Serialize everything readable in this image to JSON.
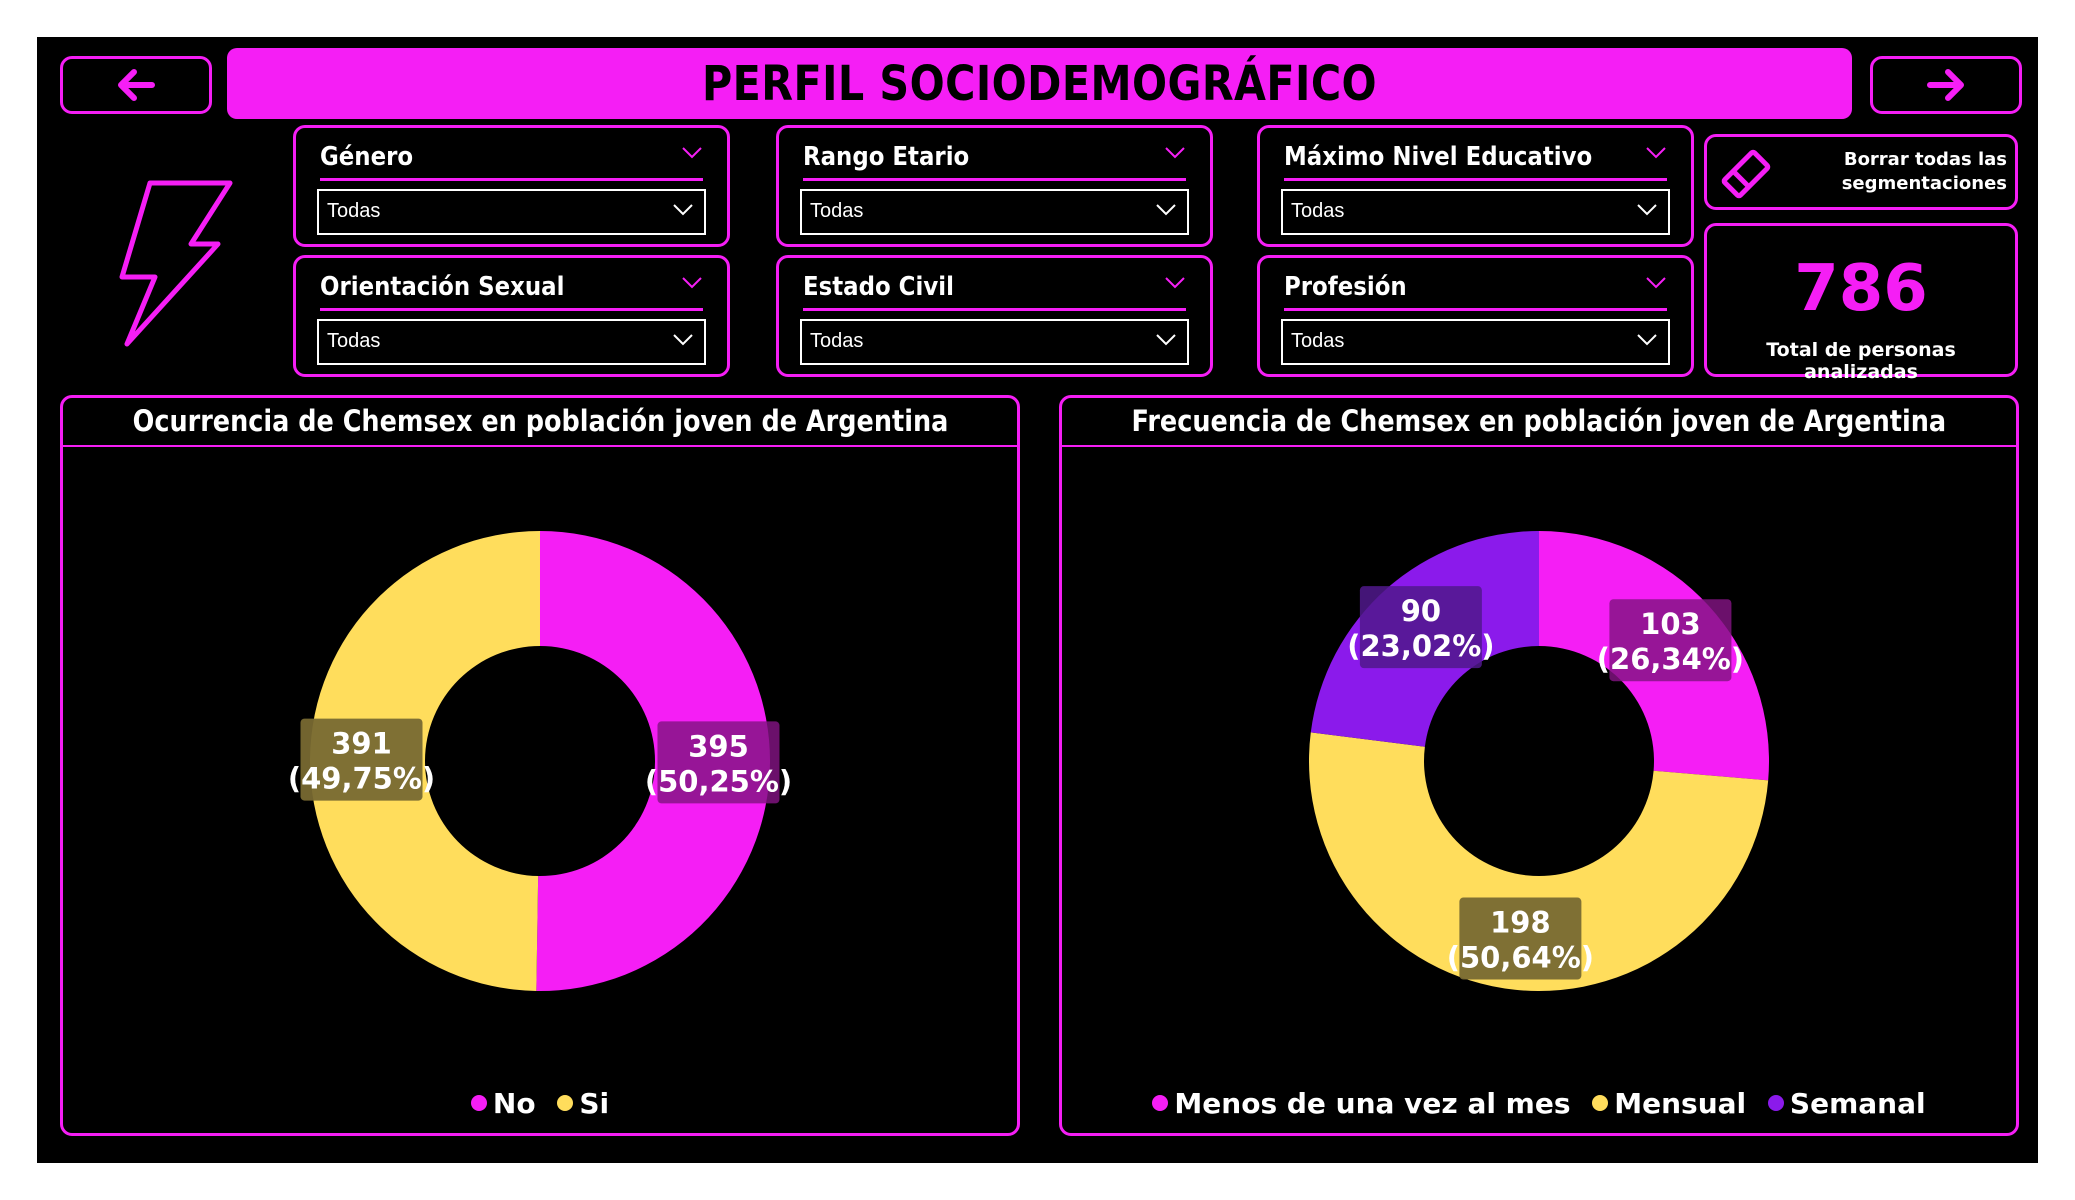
{
  "header": {
    "title": "PERFIL SOCIODEMOGRÁFICO",
    "back_icon": "arrow-left-icon",
    "forward_icon": "arrow-right-icon",
    "logo_icon": "lightning-bolt-icon"
  },
  "filters": [
    {
      "label": "Género",
      "value": "Todas"
    },
    {
      "label": "Rango Etario",
      "value": "Todas"
    },
    {
      "label": "Máximo Nivel Educativo",
      "value": "Todas"
    },
    {
      "label": "Orientación Sexual",
      "value": "Todas"
    },
    {
      "label": "Estado Civil",
      "value": "Todas"
    },
    {
      "label": "Profesión",
      "value": "Todas"
    }
  ],
  "clear_button": {
    "label_line1": "Borrar todas las",
    "label_line2": "segmentaciones",
    "icon": "eraser-icon"
  },
  "kpi": {
    "value": "786",
    "label": "Total de personas analizadas"
  },
  "colors": {
    "accent": "#f51ef5",
    "yellow": "#ffdd5c",
    "purple": "#8b1aeb",
    "background": "#000000"
  },
  "chart_data": [
    {
      "type": "pie",
      "title": "Ocurrencia de Chemsex en población joven de Argentina",
      "categories": [
        "No",
        "Si"
      ],
      "values": [
        395,
        391
      ],
      "labels": [
        {
          "value": "395",
          "percent": "(50,25%)"
        },
        {
          "value": "391",
          "percent": "(49,75%)"
        }
      ],
      "colors": [
        "#f51ef5",
        "#ffdd5c"
      ],
      "donut": true,
      "legend": "bottom-center"
    },
    {
      "type": "pie",
      "title": "Frecuencia de Chemsex en población joven de Argentina",
      "categories": [
        "Menos de una vez al mes",
        "Mensual",
        "Semanal"
      ],
      "values": [
        103,
        198,
        90
      ],
      "labels": [
        {
          "value": "103",
          "percent": "(26,34%)"
        },
        {
          "value": "198",
          "percent": "(50,64%)"
        },
        {
          "value": "90",
          "percent": "(23,02%)"
        }
      ],
      "colors": [
        "#f51ef5",
        "#ffdd5c",
        "#8b1aeb"
      ],
      "donut": true,
      "legend": "bottom-center"
    }
  ]
}
